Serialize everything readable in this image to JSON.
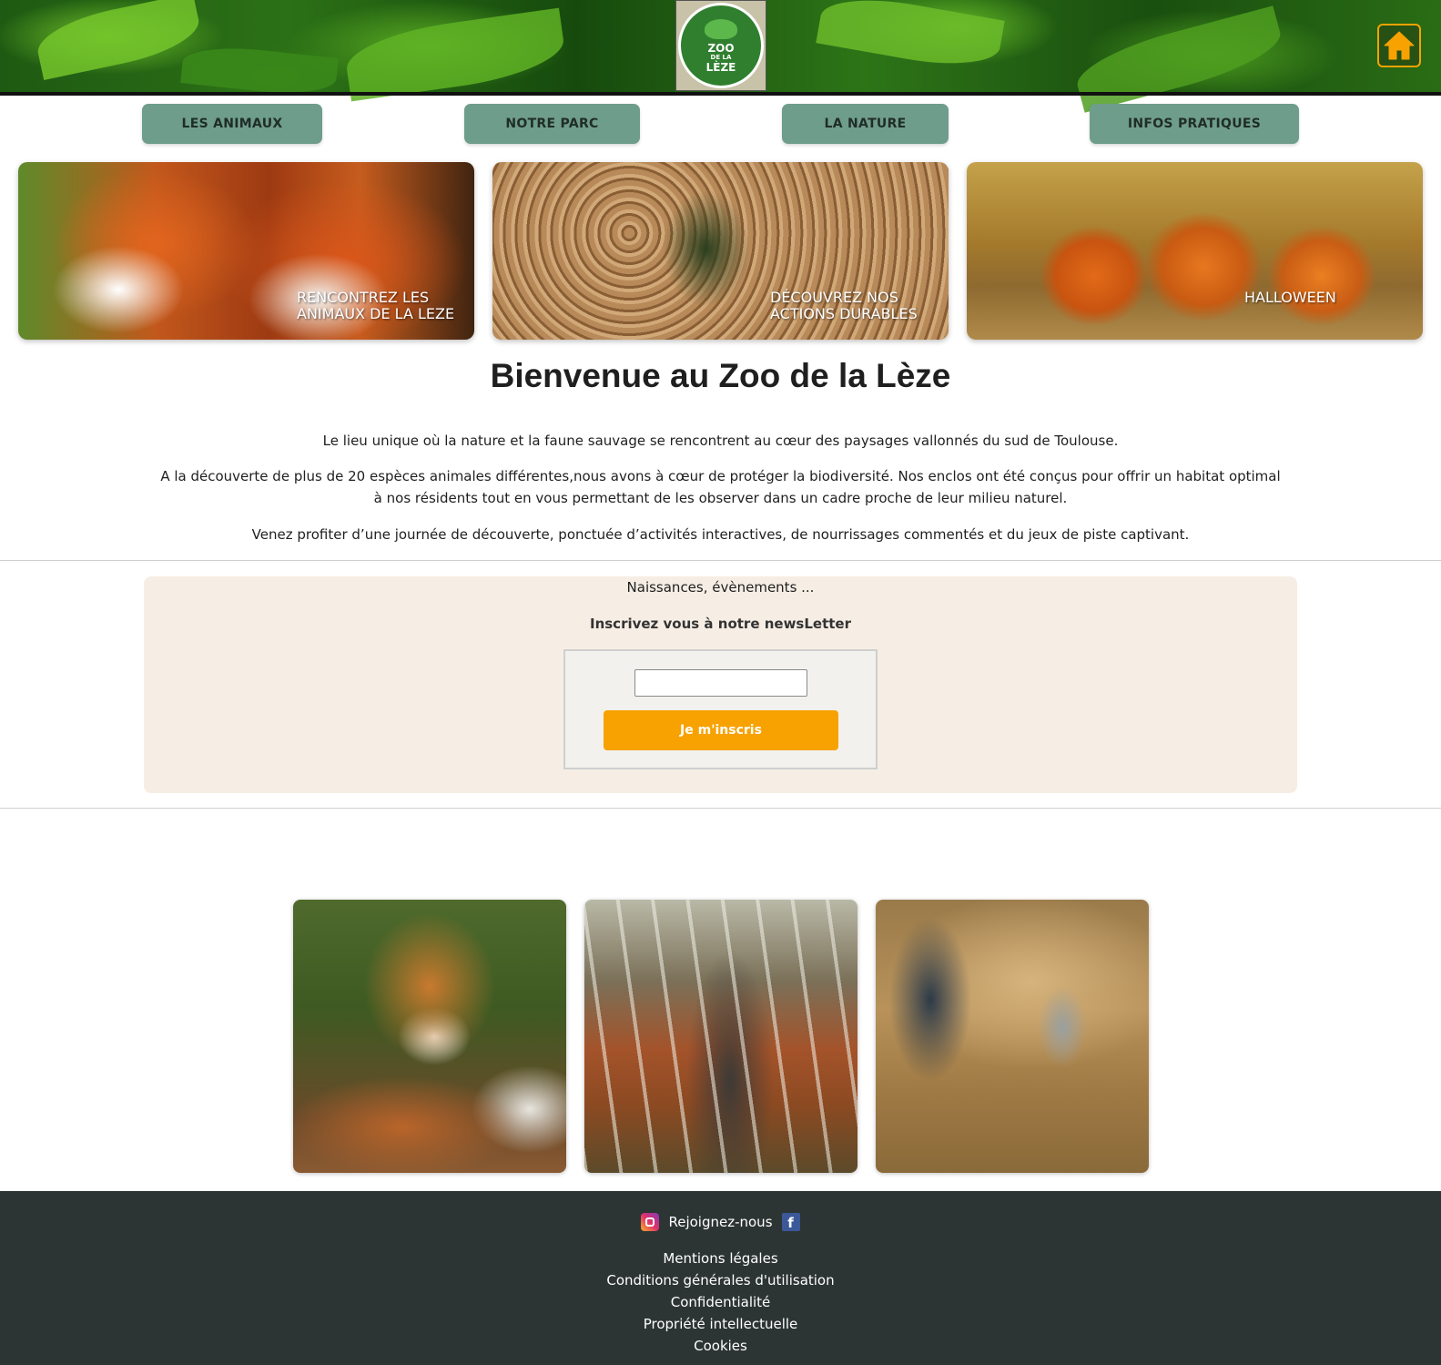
{
  "header": {
    "logo": {
      "line1": "ZOO",
      "line2": "DE LA",
      "line3": "LÈZE",
      "icon": "zoo-logo-icon"
    },
    "home_icon": "home-icon"
  },
  "nav": {
    "items": [
      {
        "label": "LES ANIMAUX"
      },
      {
        "label": "NOTRE PARC"
      },
      {
        "label": "LA NATURE"
      },
      {
        "label": "INFOS PRATIQUES"
      }
    ]
  },
  "cards": [
    {
      "line1": "Rencontrez les",
      "line2": "animaux de la Leze"
    },
    {
      "line1": "Découvrez nos",
      "line2": "actions durables"
    },
    {
      "line1": "Halloween",
      "line2": ""
    }
  ],
  "welcome": {
    "title": "Bienvenue au Zoo de la Lèze",
    "p1": "Le lieu unique où la nature et la faune sauvage se rencontrent au cœur des paysages vallonnés du sud de Toulouse.",
    "p2": "A la découverte de plus de 20 espèces animales différentes,nous avons à cœur de protéger la biodiversité. Nos enclos ont été conçus pour offrir un habitat optimal à nos résidents tout en vous permettant de les observer dans un cadre proche de leur milieu naturel.",
    "p3": "Venez profiter d’une journée de découverte, ponctuée d’activités interactives, de nourrissages commentés et du jeux de piste captivant."
  },
  "newsletter": {
    "tagline": "Naissances, évènements ...",
    "heading": "Inscrivez vous à notre newsLetter",
    "email_value": "",
    "email_placeholder": "",
    "button_label": "Je m'inscris",
    "button_color": "#f7a200"
  },
  "footer": {
    "join_label": "Rejoignez-nous",
    "links": [
      "Mentions légales",
      "Conditions générales d'utilisation",
      "Confidentialité",
      "Propriété intellectuelle",
      "Cookies"
    ]
  },
  "colors": {
    "nav_button": "#6f9d8c",
    "accent": "#f7a200",
    "newsletter_bg": "#f6eee4",
    "footer_bg": "#2d3534"
  }
}
